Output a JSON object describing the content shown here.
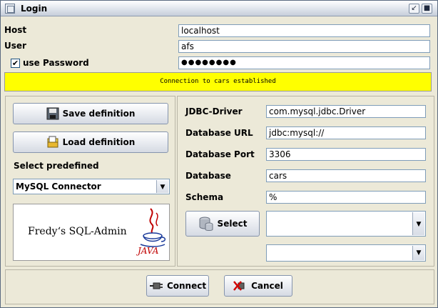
{
  "window": {
    "title": "Login"
  },
  "connection": {
    "host_label": "Host",
    "host_value": "localhost",
    "user_label": "User",
    "user_value": "afs",
    "use_password_label": "use Password",
    "use_password_checked": true,
    "password_value": "●●●●●●●●",
    "status_message": "Connection to cars established"
  },
  "left_panel": {
    "save_label": "Save definition",
    "load_label": "Load definition",
    "select_predefined_label": "Select predefined",
    "predefined_value": "MySQL Connector",
    "logo_text": "Fredy‘s SQL-Admin",
    "java_logo_text": "JAVA"
  },
  "right_panel": {
    "jdbc_driver_label": "JDBC-Driver",
    "jdbc_driver_value": "com.mysql.jdbc.Driver",
    "database_url_label": "Database URL",
    "database_url_value": "jdbc:mysql://",
    "database_port_label": "Database Port",
    "database_port_value": "3306",
    "database_label": "Database",
    "database_value": "cars",
    "schema_label": "Schema",
    "schema_value": "%",
    "select_label": "Select"
  },
  "footer": {
    "connect_label": "Connect",
    "cancel_label": "Cancel"
  }
}
